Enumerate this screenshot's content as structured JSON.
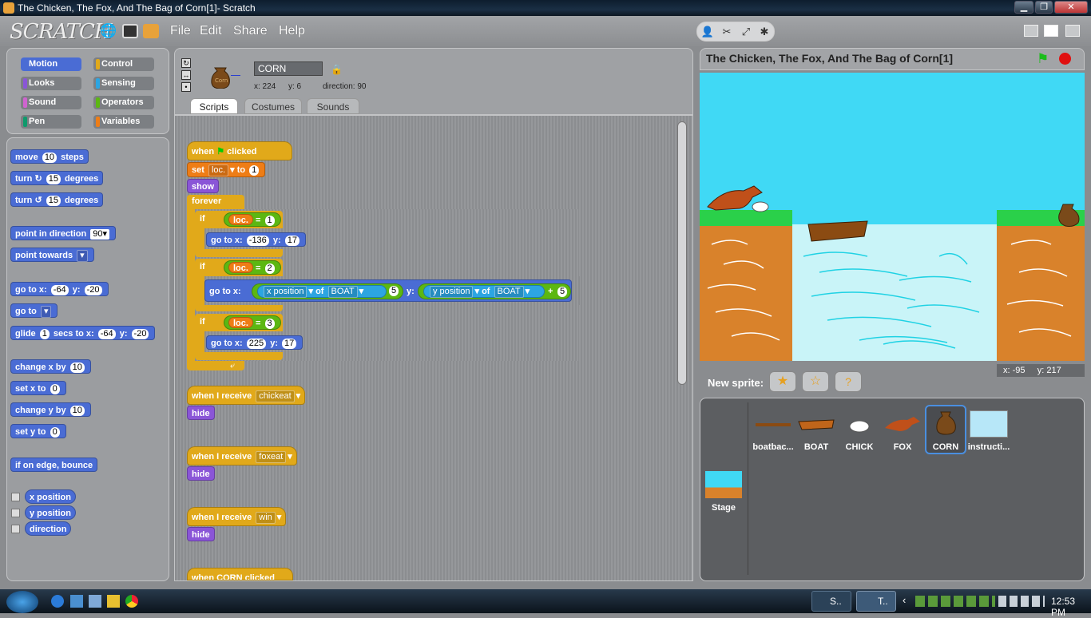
{
  "window": {
    "title": "The Chicken, The Fox, And The Bag of Corn[1]- Scratch",
    "min": "▁",
    "max": "❐",
    "close": "✕"
  },
  "menubar": {
    "logo": "SCRATCH",
    "file": "File",
    "edit": "Edit",
    "share": "Share",
    "help": "Help"
  },
  "categories": {
    "motion": "Motion",
    "control": "Control",
    "looks": "Looks",
    "sensing": "Sensing",
    "sound": "Sound",
    "operators": "Operators",
    "pen": "Pen",
    "variables": "Variables"
  },
  "palette": {
    "move": "move",
    "move_n": "10",
    "steps": "steps",
    "turn": "turn",
    "turn_n": "15",
    "degrees": "degrees",
    "turn2_n": "15",
    "point_dir": "point in direction",
    "point_dir_v": "90▾",
    "point_towards": "point towards",
    "goto_xy": "go to x:",
    "goto_x": "-64",
    "y": "y:",
    "goto_y": "-20",
    "goto": "go to",
    "glide": "glide",
    "glide_n": "1",
    "secs_to_x": "secs to x:",
    "glide_x": "-64",
    "glide_y": "-20",
    "change_x": "change x by",
    "change_x_n": "10",
    "set_x": "set x to",
    "set_x_n": "0",
    "change_y": "change y by",
    "change_y_n": "10",
    "set_y": "set y to",
    "set_y_n": "0",
    "bounce": "if on edge, bounce",
    "xpos": "x position",
    "ypos": "y position",
    "direction": "direction"
  },
  "sprite": {
    "name": "CORN",
    "x": "x: 224",
    "y": "y: 6",
    "direction": "direction: 90"
  },
  "tabs": {
    "scripts": "Scripts",
    "costumes": "Costumes",
    "sounds": "Sounds"
  },
  "script": {
    "when": "when",
    "clicked": "clicked",
    "set": "set",
    "loc": "loc.",
    "to": "to",
    "set_val": "1",
    "show": "show",
    "forever": "forever",
    "if": "if",
    "eq": "=",
    "c1": "1",
    "c2": "2",
    "c3": "3",
    "goto": "go to x:",
    "y": "y:",
    "x1": "-136",
    "y1": "17",
    "xpos": "x position",
    "ypos": "y position",
    "of": "of",
    "boat": "BOAT",
    "minus": "-",
    "plus": "+",
    "five": "5",
    "x3": "225",
    "y3": "17",
    "receive": "when I receive",
    "chickeat": "chickeat",
    "foxeat": "foxeat",
    "win": "win",
    "hide": "hide",
    "corn_clicked": "when CORN clicked"
  },
  "stage": {
    "title": "The Chicken, The Fox, And The Bag of Corn[1]",
    "mouse_x": "x: -95",
    "mouse_y": "y: 217"
  },
  "newsprite": {
    "label": "New sprite:"
  },
  "sprites": [
    "boatbac...",
    "BOAT",
    "CHICK",
    "FOX",
    "CORN",
    "instructi..."
  ],
  "stage_thumb": "Stage",
  "taskbar": {
    "task1": "S..",
    "task2": "T..",
    "time": "12:53 PM"
  },
  "colors": {
    "motion": "#4a6cd4",
    "looks": "#8a55d7",
    "control": "#e1a91a",
    "variables": "#ee7d16",
    "operators": "#5cb712",
    "sensing": "#2ca5e2"
  }
}
